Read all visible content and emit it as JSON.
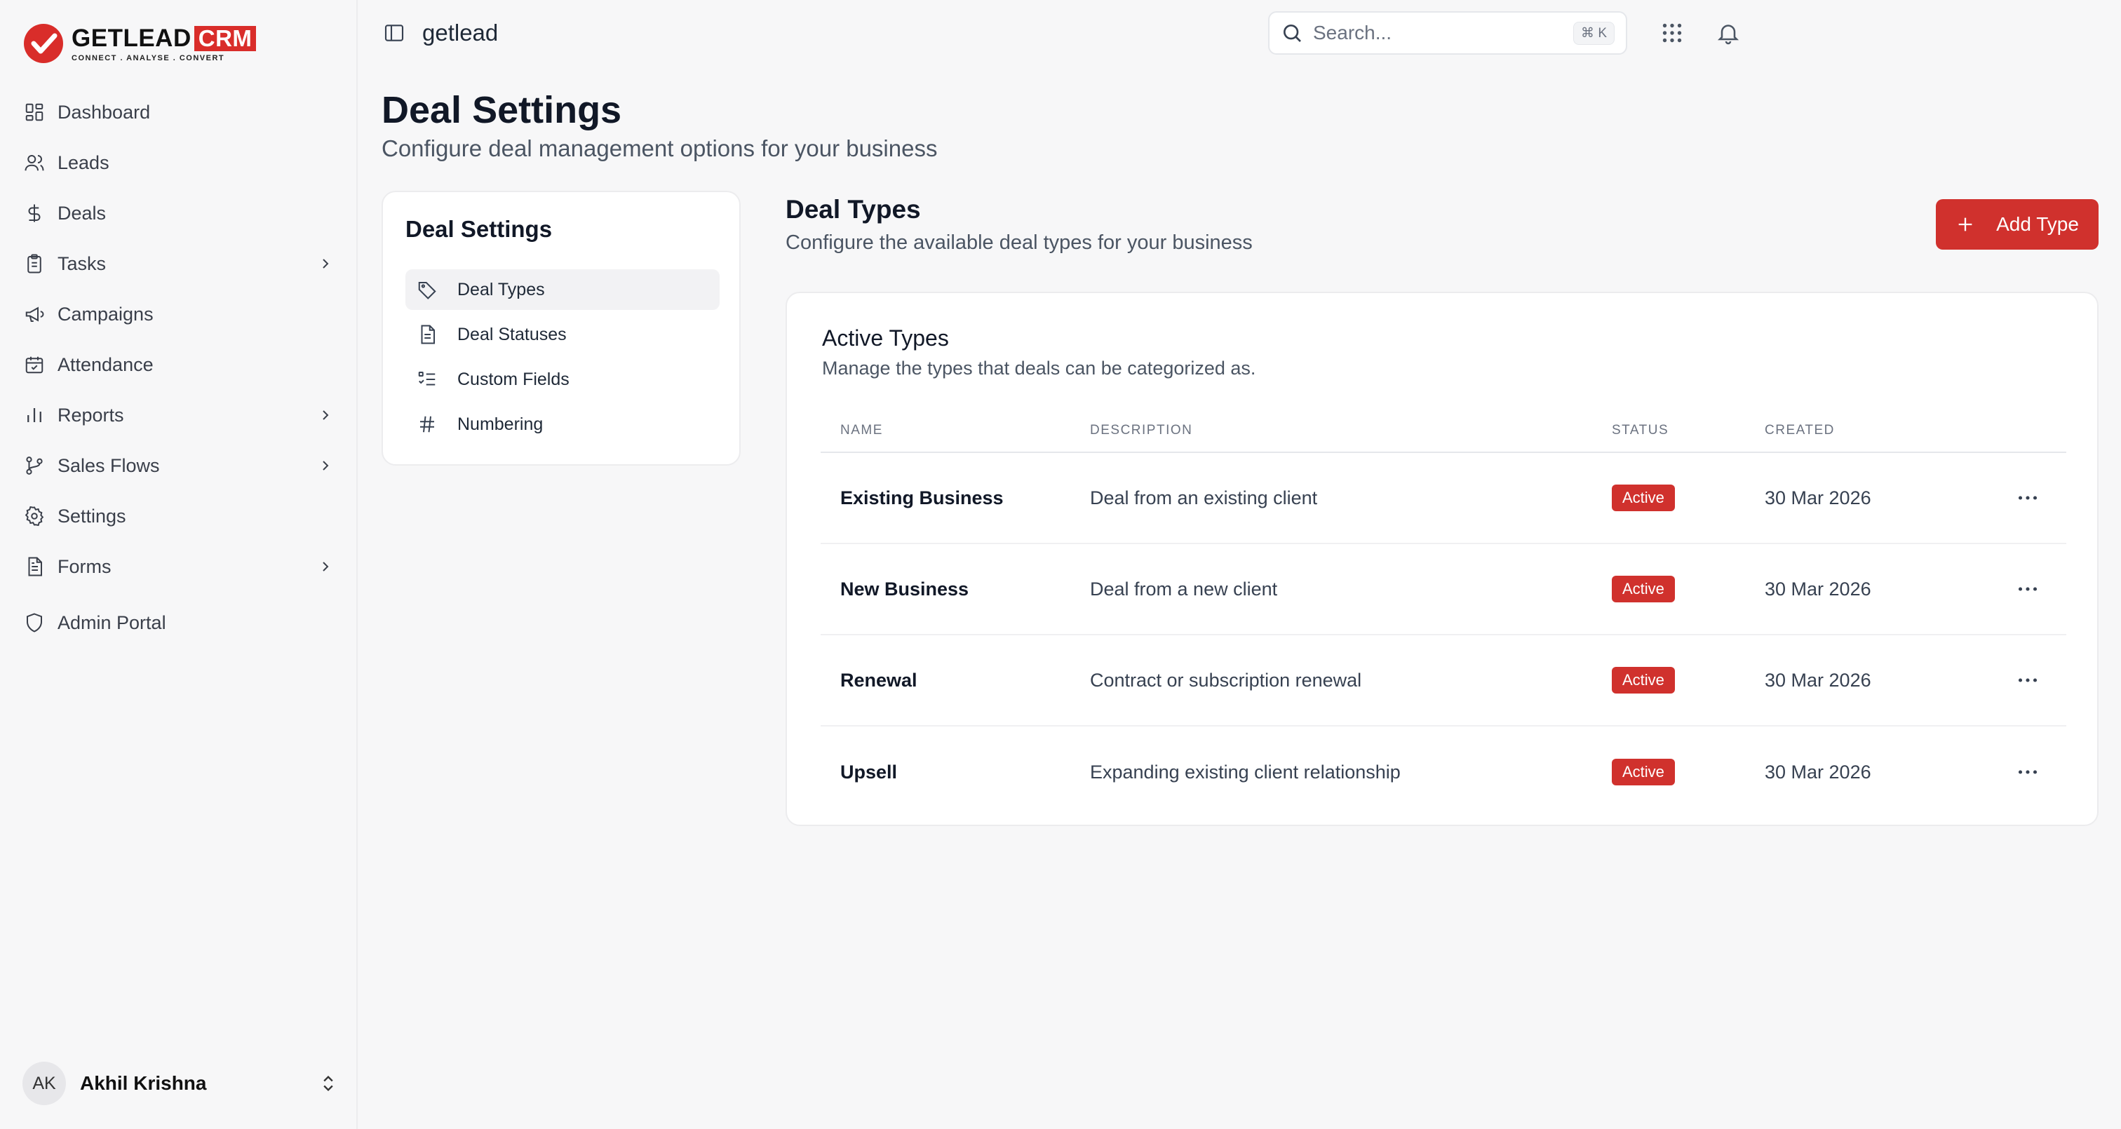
{
  "brand": {
    "name": "GETLEAD",
    "crm": "CRM",
    "tagline": "CONNECT  .  ANALYSE  .  CONVERT",
    "accent_color": "#d0312d"
  },
  "sidebar": {
    "items": [
      {
        "label": "Dashboard",
        "icon": "grid-icon"
      },
      {
        "label": "Leads",
        "icon": "users-icon"
      },
      {
        "label": "Deals",
        "icon": "dollar-icon"
      },
      {
        "label": "Tasks",
        "icon": "clipboard-icon",
        "has_submenu": true
      },
      {
        "label": "Campaigns",
        "icon": "megaphone-icon"
      },
      {
        "label": "Attendance",
        "icon": "calendar-check-icon"
      },
      {
        "label": "Reports",
        "icon": "bar-chart-icon",
        "has_submenu": true
      },
      {
        "label": "Sales Flows",
        "icon": "git-branch-icon",
        "has_submenu": true
      },
      {
        "label": "Settings",
        "icon": "gear-icon"
      },
      {
        "label": "Forms",
        "icon": "file-text-icon",
        "has_submenu": true
      },
      {
        "label": "Admin Portal",
        "icon": "shield-icon"
      }
    ],
    "user": {
      "initials": "AK",
      "name": "Akhil Krishna"
    }
  },
  "topbar": {
    "workspace": "getlead",
    "search": {
      "placeholder": "Search...",
      "shortcut": "⌘ K"
    }
  },
  "page": {
    "title": "Deal Settings",
    "subtitle": "Configure deal management options for your business"
  },
  "settings_nav": {
    "title": "Deal Settings",
    "items": [
      {
        "label": "Deal Types",
        "icon": "tag-icon",
        "active": true
      },
      {
        "label": "Deal Statuses",
        "icon": "file-icon"
      },
      {
        "label": "Custom Fields",
        "icon": "list-checks-icon"
      },
      {
        "label": "Numbering",
        "icon": "hash-icon"
      }
    ]
  },
  "section": {
    "title": "Deal Types",
    "subtitle": "Configure the available deal types for your business",
    "add_button": "Add Type"
  },
  "types_card": {
    "title": "Active Types",
    "subtitle": "Manage the types that deals can be categorized as.",
    "columns": [
      "NAME",
      "DESCRIPTION",
      "STATUS",
      "CREATED"
    ],
    "rows": [
      {
        "name": "Existing Business",
        "description": "Deal from an existing client",
        "status": "Active",
        "created": "30 Mar 2026"
      },
      {
        "name": "New Business",
        "description": "Deal from a new client",
        "status": "Active",
        "created": "30 Mar 2026"
      },
      {
        "name": "Renewal",
        "description": "Contract or subscription renewal",
        "status": "Active",
        "created": "30 Mar 2026"
      },
      {
        "name": "Upsell",
        "description": "Expanding existing client relationship",
        "status": "Active",
        "created": "30 Mar 2026"
      }
    ]
  }
}
